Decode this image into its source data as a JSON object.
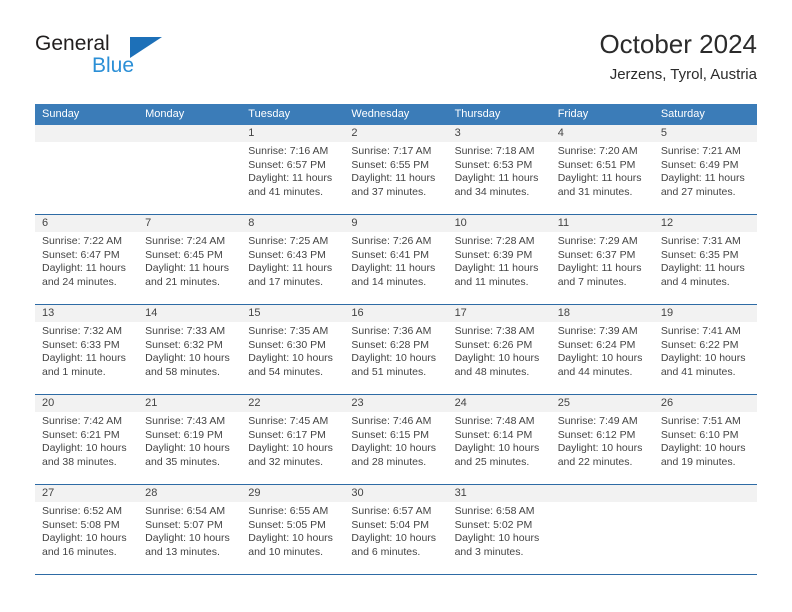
{
  "brand": {
    "name_part1": "General",
    "name_part2": "Blue",
    "triangle_color": "#1d70b8",
    "blue_color": "#2b8fd6"
  },
  "header": {
    "title": "October 2024",
    "subtitle": "Jerzens, Tyrol, Austria"
  },
  "theme": {
    "header_blue": "#3b7cb8",
    "divider_blue": "#2e6ba5",
    "daynum_band": "#f2f2f2",
    "text": "#444444"
  },
  "calendar": {
    "weekday_headers": [
      "Sunday",
      "Monday",
      "Tuesday",
      "Wednesday",
      "Thursday",
      "Friday",
      "Saturday"
    ],
    "weeks": [
      [
        {
          "blank": true
        },
        {
          "blank": true
        },
        {
          "date": "1",
          "sunrise": "Sunrise: 7:16 AM",
          "sunset": "Sunset: 6:57 PM",
          "daylight": "Daylight: 11 hours and 41 minutes."
        },
        {
          "date": "2",
          "sunrise": "Sunrise: 7:17 AM",
          "sunset": "Sunset: 6:55 PM",
          "daylight": "Daylight: 11 hours and 37 minutes."
        },
        {
          "date": "3",
          "sunrise": "Sunrise: 7:18 AM",
          "sunset": "Sunset: 6:53 PM",
          "daylight": "Daylight: 11 hours and 34 minutes."
        },
        {
          "date": "4",
          "sunrise": "Sunrise: 7:20 AM",
          "sunset": "Sunset: 6:51 PM",
          "daylight": "Daylight: 11 hours and 31 minutes."
        },
        {
          "date": "5",
          "sunrise": "Sunrise: 7:21 AM",
          "sunset": "Sunset: 6:49 PM",
          "daylight": "Daylight: 11 hours and 27 minutes."
        }
      ],
      [
        {
          "date": "6",
          "sunrise": "Sunrise: 7:22 AM",
          "sunset": "Sunset: 6:47 PM",
          "daylight": "Daylight: 11 hours and 24 minutes."
        },
        {
          "date": "7",
          "sunrise": "Sunrise: 7:24 AM",
          "sunset": "Sunset: 6:45 PM",
          "daylight": "Daylight: 11 hours and 21 minutes."
        },
        {
          "date": "8",
          "sunrise": "Sunrise: 7:25 AM",
          "sunset": "Sunset: 6:43 PM",
          "daylight": "Daylight: 11 hours and 17 minutes."
        },
        {
          "date": "9",
          "sunrise": "Sunrise: 7:26 AM",
          "sunset": "Sunset: 6:41 PM",
          "daylight": "Daylight: 11 hours and 14 minutes."
        },
        {
          "date": "10",
          "sunrise": "Sunrise: 7:28 AM",
          "sunset": "Sunset: 6:39 PM",
          "daylight": "Daylight: 11 hours and 11 minutes."
        },
        {
          "date": "11",
          "sunrise": "Sunrise: 7:29 AM",
          "sunset": "Sunset: 6:37 PM",
          "daylight": "Daylight: 11 hours and 7 minutes."
        },
        {
          "date": "12",
          "sunrise": "Sunrise: 7:31 AM",
          "sunset": "Sunset: 6:35 PM",
          "daylight": "Daylight: 11 hours and 4 minutes."
        }
      ],
      [
        {
          "date": "13",
          "sunrise": "Sunrise: 7:32 AM",
          "sunset": "Sunset: 6:33 PM",
          "daylight": "Daylight: 11 hours and 1 minute."
        },
        {
          "date": "14",
          "sunrise": "Sunrise: 7:33 AM",
          "sunset": "Sunset: 6:32 PM",
          "daylight": "Daylight: 10 hours and 58 minutes."
        },
        {
          "date": "15",
          "sunrise": "Sunrise: 7:35 AM",
          "sunset": "Sunset: 6:30 PM",
          "daylight": "Daylight: 10 hours and 54 minutes."
        },
        {
          "date": "16",
          "sunrise": "Sunrise: 7:36 AM",
          "sunset": "Sunset: 6:28 PM",
          "daylight": "Daylight: 10 hours and 51 minutes."
        },
        {
          "date": "17",
          "sunrise": "Sunrise: 7:38 AM",
          "sunset": "Sunset: 6:26 PM",
          "daylight": "Daylight: 10 hours and 48 minutes."
        },
        {
          "date": "18",
          "sunrise": "Sunrise: 7:39 AM",
          "sunset": "Sunset: 6:24 PM",
          "daylight": "Daylight: 10 hours and 44 minutes."
        },
        {
          "date": "19",
          "sunrise": "Sunrise: 7:41 AM",
          "sunset": "Sunset: 6:22 PM",
          "daylight": "Daylight: 10 hours and 41 minutes."
        }
      ],
      [
        {
          "date": "20",
          "sunrise": "Sunrise: 7:42 AM",
          "sunset": "Sunset: 6:21 PM",
          "daylight": "Daylight: 10 hours and 38 minutes."
        },
        {
          "date": "21",
          "sunrise": "Sunrise: 7:43 AM",
          "sunset": "Sunset: 6:19 PM",
          "daylight": "Daylight: 10 hours and 35 minutes."
        },
        {
          "date": "22",
          "sunrise": "Sunrise: 7:45 AM",
          "sunset": "Sunset: 6:17 PM",
          "daylight": "Daylight: 10 hours and 32 minutes."
        },
        {
          "date": "23",
          "sunrise": "Sunrise: 7:46 AM",
          "sunset": "Sunset: 6:15 PM",
          "daylight": "Daylight: 10 hours and 28 minutes."
        },
        {
          "date": "24",
          "sunrise": "Sunrise: 7:48 AM",
          "sunset": "Sunset: 6:14 PM",
          "daylight": "Daylight: 10 hours and 25 minutes."
        },
        {
          "date": "25",
          "sunrise": "Sunrise: 7:49 AM",
          "sunset": "Sunset: 6:12 PM",
          "daylight": "Daylight: 10 hours and 22 minutes."
        },
        {
          "date": "26",
          "sunrise": "Sunrise: 7:51 AM",
          "sunset": "Sunset: 6:10 PM",
          "daylight": "Daylight: 10 hours and 19 minutes."
        }
      ],
      [
        {
          "date": "27",
          "sunrise": "Sunrise: 6:52 AM",
          "sunset": "Sunset: 5:08 PM",
          "daylight": "Daylight: 10 hours and 16 minutes."
        },
        {
          "date": "28",
          "sunrise": "Sunrise: 6:54 AM",
          "sunset": "Sunset: 5:07 PM",
          "daylight": "Daylight: 10 hours and 13 minutes."
        },
        {
          "date": "29",
          "sunrise": "Sunrise: 6:55 AM",
          "sunset": "Sunset: 5:05 PM",
          "daylight": "Daylight: 10 hours and 10 minutes."
        },
        {
          "date": "30",
          "sunrise": "Sunrise: 6:57 AM",
          "sunset": "Sunset: 5:04 PM",
          "daylight": "Daylight: 10 hours and 6 minutes."
        },
        {
          "date": "31",
          "sunrise": "Sunrise: 6:58 AM",
          "sunset": "Sunset: 5:02 PM",
          "daylight": "Daylight: 10 hours and 3 minutes."
        },
        {
          "blank": true
        },
        {
          "blank": true
        }
      ]
    ]
  }
}
